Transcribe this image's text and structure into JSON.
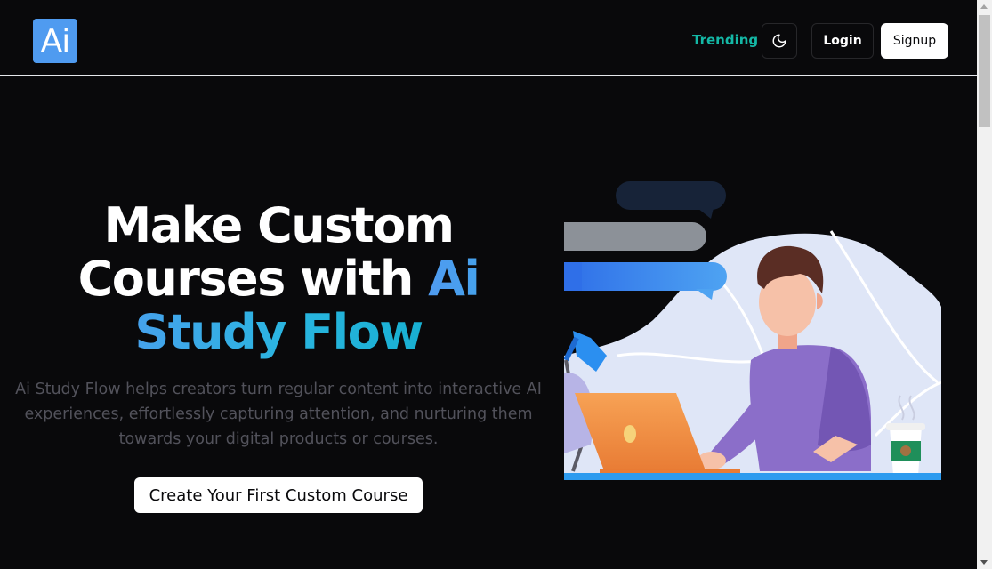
{
  "header": {
    "logo_text": "Ai",
    "trending_label": "Trending",
    "theme_toggle_icon": "moon-icon",
    "login_label": "Login",
    "signup_label": "Signup"
  },
  "hero": {
    "title_part1": "Make Custom Courses with ",
    "title_highlight": "Ai Study Flow",
    "subtitle": "Ai Study Flow helps creators turn regular content into interactive AI experiences, effortlessly capturing attention, and nurturing them towards your digital products or courses.",
    "cta_label": "Create Your First Custom Course"
  },
  "illustration": {
    "icon": "person-at-laptop-illustration"
  },
  "colors": {
    "background": "#09090b",
    "accent_teal": "#14b8a6",
    "accent_blue": "#4f9bf0",
    "accent_cyan": "#18b0d2",
    "subtitle_gray": "#52525b"
  }
}
